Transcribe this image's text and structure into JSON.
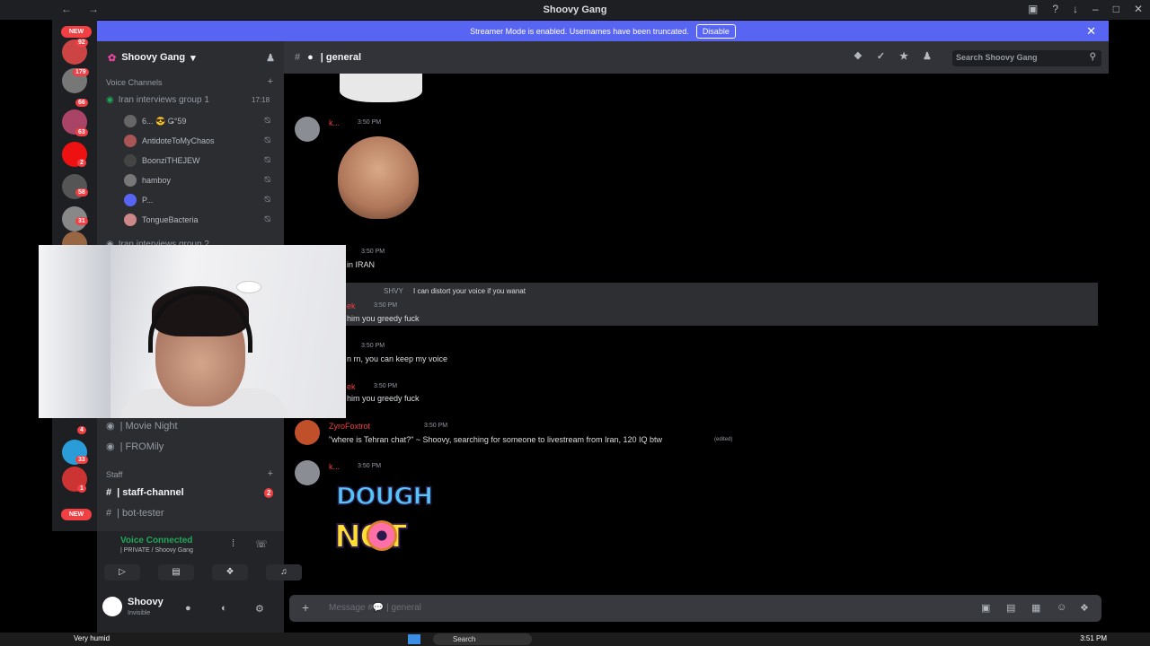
{
  "window": {
    "title": "Shoovy Gang"
  },
  "banner": {
    "text": "Streamer Mode is enabled. Usernames have been truncated.",
    "button": "Disable"
  },
  "guilds": {
    "new_top": "NEW",
    "new_bottom": "NEW",
    "badges": [
      "92",
      "179",
      "66",
      "63",
      "2",
      "58",
      "31",
      "4",
      "33",
      "1"
    ]
  },
  "server": {
    "name": "Shoovy Gang"
  },
  "sidebar": {
    "voice_category": "Voice Channels",
    "voice_channel": "Iran interviews group 1",
    "voice_timer": "17:18",
    "members": [
      "6... 😎 Ǥ°59",
      "AntidoteToMyChaos",
      "BoonziTHEJEW",
      "hamboy",
      "P...",
      "TongueBacteria"
    ],
    "voice_channel_2": "Iran interviews group 2",
    "movie_night": "| Movie Night",
    "fromily": "| FROMily",
    "staff_category": "Staff",
    "staff_channel": "| staff-channel",
    "staff_badge": "2",
    "bot_tester": "| bot-tester"
  },
  "voice_bar": {
    "status": "Voice Connected",
    "sub": "| PRIVATE / Shoovy Gang"
  },
  "user": {
    "name": "Shoovy",
    "status": "Invisible"
  },
  "channel": {
    "name": "| general",
    "search_placeholder": "Search Shoovy Gang"
  },
  "messages": [
    {
      "author": "k...",
      "time": "3:50 PM"
    },
    {
      "time": "3:50 PM",
      "text": "in IRAN"
    },
    {
      "reply": "I can distort your voice if you wanat",
      "reply_tag": "SHVY",
      "author": "ek",
      "time": "3:50 PM",
      "text": "him you greedy fuck"
    },
    {
      "time": "3:50 PM",
      "text": "n rn, you can keep my voice"
    },
    {
      "author": "ek",
      "time": "3:50 PM",
      "text": "him you greedy fuck"
    },
    {
      "author": "ZyroFoxtrot",
      "time": "3:50 PM",
      "text": "\"where is Tehran chat?\" ~ Shoovy, searching for someone to livestream from Iran, 120 IQ btw",
      "edited": "(edited)"
    },
    {
      "author": "k...",
      "time": "3:50 PM"
    }
  ],
  "sticker": {
    "line1": "DOUGH",
    "line2": "NOT"
  },
  "composer": {
    "placeholder": "Message #💬 | general"
  },
  "taskbar": {
    "weather": "Very humid",
    "search": "Search",
    "clock": "3:51 PM"
  }
}
